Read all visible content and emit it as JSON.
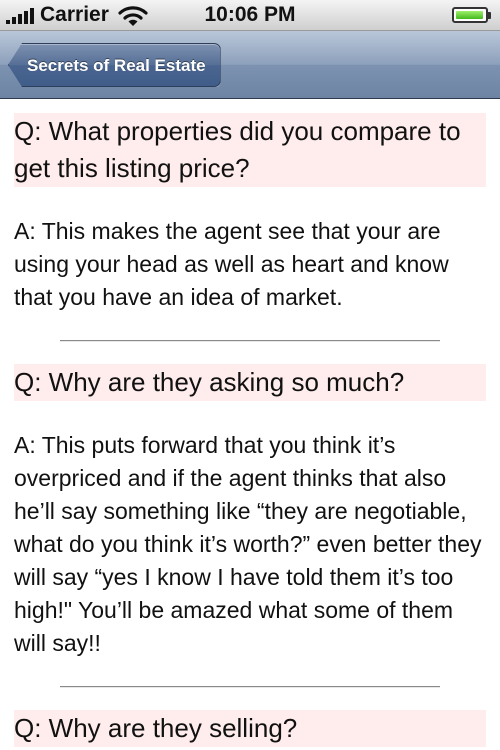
{
  "status_bar": {
    "carrier": "Carrier",
    "time": "10:06 PM",
    "icons": [
      "signal-icon",
      "wifi-icon",
      "battery-icon"
    ]
  },
  "nav_bar": {
    "back_label": "Secrets of Real Estate",
    "tint_color": "#6d84a4"
  },
  "content": {
    "question_highlight_color": "#ffecec",
    "items": [
      {
        "question": "Q: What properties did you compare to get this listing price?",
        "answer": "A: This makes the agent see that your are using your head as well as heart and know that you have an idea of market."
      },
      {
        "question": "Q: Why are they asking so much?",
        "answer": "A: This puts forward that you think it’s overpriced and if the agent thinks that also he’ll say something like “they are negotiable, what do you think it’s worth?” even better they will say “yes I know I have told them it’s too high!\" You’ll be amazed what some of them will say!!"
      },
      {
        "question": "Q: Why are they selling?"
      }
    ]
  }
}
